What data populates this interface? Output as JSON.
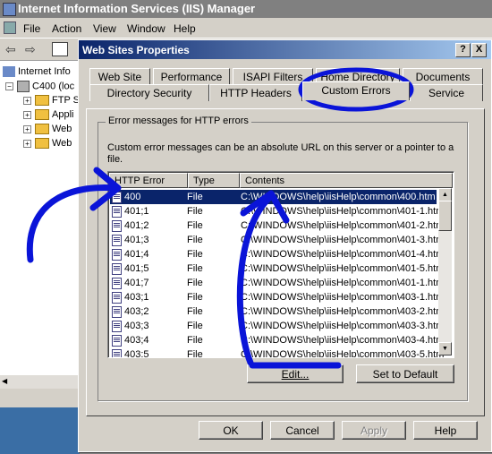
{
  "main_window": {
    "title": "Internet Information Services (IIS) Manager",
    "menu": [
      "File",
      "Action",
      "View",
      "Window",
      "Help"
    ],
    "tree": {
      "root": "Internet Info",
      "server": "C400 (loc",
      "children": [
        "FTP S",
        "Appli",
        "Web",
        "Web"
      ]
    }
  },
  "dialog": {
    "title": "Web Sites Properties",
    "help_btn": "?",
    "close_btn": "X",
    "tabs_row1": [
      "Web Site",
      "Performance",
      "ISAPI Filters",
      "Home Directory",
      "Documents"
    ],
    "tabs_row2": [
      "Directory Security",
      "HTTP Headers",
      "Custom Errors",
      "Service"
    ],
    "active_tab": "Custom Errors",
    "group_label": "Error messages for HTTP errors",
    "description": "Custom error messages can be an absolute URL on this server or a pointer to a file.",
    "columns": [
      "HTTP Error",
      "Type",
      "Contents"
    ],
    "rows": [
      {
        "code": "400",
        "type": "File",
        "contents": "C:\\WINDOWS\\help\\iisHelp\\common\\400.htm"
      },
      {
        "code": "401;1",
        "type": "File",
        "contents": "C:\\WINDOWS\\help\\iisHelp\\common\\401-1.htm"
      },
      {
        "code": "401;2",
        "type": "File",
        "contents": "C:\\WINDOWS\\help\\iisHelp\\common\\401-2.htm"
      },
      {
        "code": "401;3",
        "type": "File",
        "contents": "C:\\WINDOWS\\help\\iisHelp\\common\\401-3.htm"
      },
      {
        "code": "401;4",
        "type": "File",
        "contents": "C:\\WINDOWS\\help\\iisHelp\\common\\401-4.htm"
      },
      {
        "code": "401;5",
        "type": "File",
        "contents": "C:\\WINDOWS\\help\\iisHelp\\common\\401-5.htm"
      },
      {
        "code": "401;7",
        "type": "File",
        "contents": "C:\\WINDOWS\\help\\iisHelp\\common\\401-1.htm"
      },
      {
        "code": "403;1",
        "type": "File",
        "contents": "C:\\WINDOWS\\help\\iisHelp\\common\\403-1.htm"
      },
      {
        "code": "403;2",
        "type": "File",
        "contents": "C:\\WINDOWS\\help\\iisHelp\\common\\403-2.htm"
      },
      {
        "code": "403;3",
        "type": "File",
        "contents": "C:\\WINDOWS\\help\\iisHelp\\common\\403-3.htm"
      },
      {
        "code": "403;4",
        "type": "File",
        "contents": "C:\\WINDOWS\\help\\iisHelp\\common\\403-4.htm"
      },
      {
        "code": "403;5",
        "type": "File",
        "contents": "C:\\WINDOWS\\help\\iisHelp\\common\\403-5.htm"
      }
    ],
    "selected_row": "400",
    "edit_btn": "Edit...",
    "default_btn": "Set to Default",
    "ok_btn": "OK",
    "cancel_btn": "Cancel",
    "apply_btn": "Apply",
    "help_button": "Help"
  },
  "annotation_color": "#0a14d8"
}
